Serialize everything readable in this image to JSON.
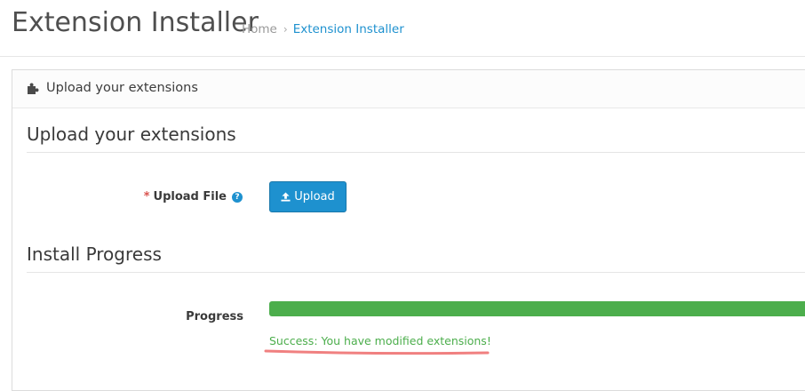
{
  "header": {
    "title": "Extension Installer",
    "breadcrumb": {
      "home": "Home",
      "separator": "›",
      "current": "Extension Installer"
    }
  },
  "panel": {
    "heading": "Upload your extensions",
    "heading_icon": "puzzle-icon",
    "upload_section": {
      "legend": "Upload your extensions",
      "required_mark": "*",
      "label": "Upload File",
      "help_icon": "question-circle-icon",
      "help_glyph": "?",
      "button_label": "Upload",
      "button_icon": "upload-icon"
    },
    "progress_section": {
      "legend": "Install Progress",
      "label": "Progress",
      "progress_percent": 100,
      "status_text": "Success: You have modified extensions!"
    }
  },
  "colors": {
    "accent": "#1e91cf",
    "success": "#4cae4c",
    "required": "#d9534f",
    "annotation": "#f08080"
  }
}
